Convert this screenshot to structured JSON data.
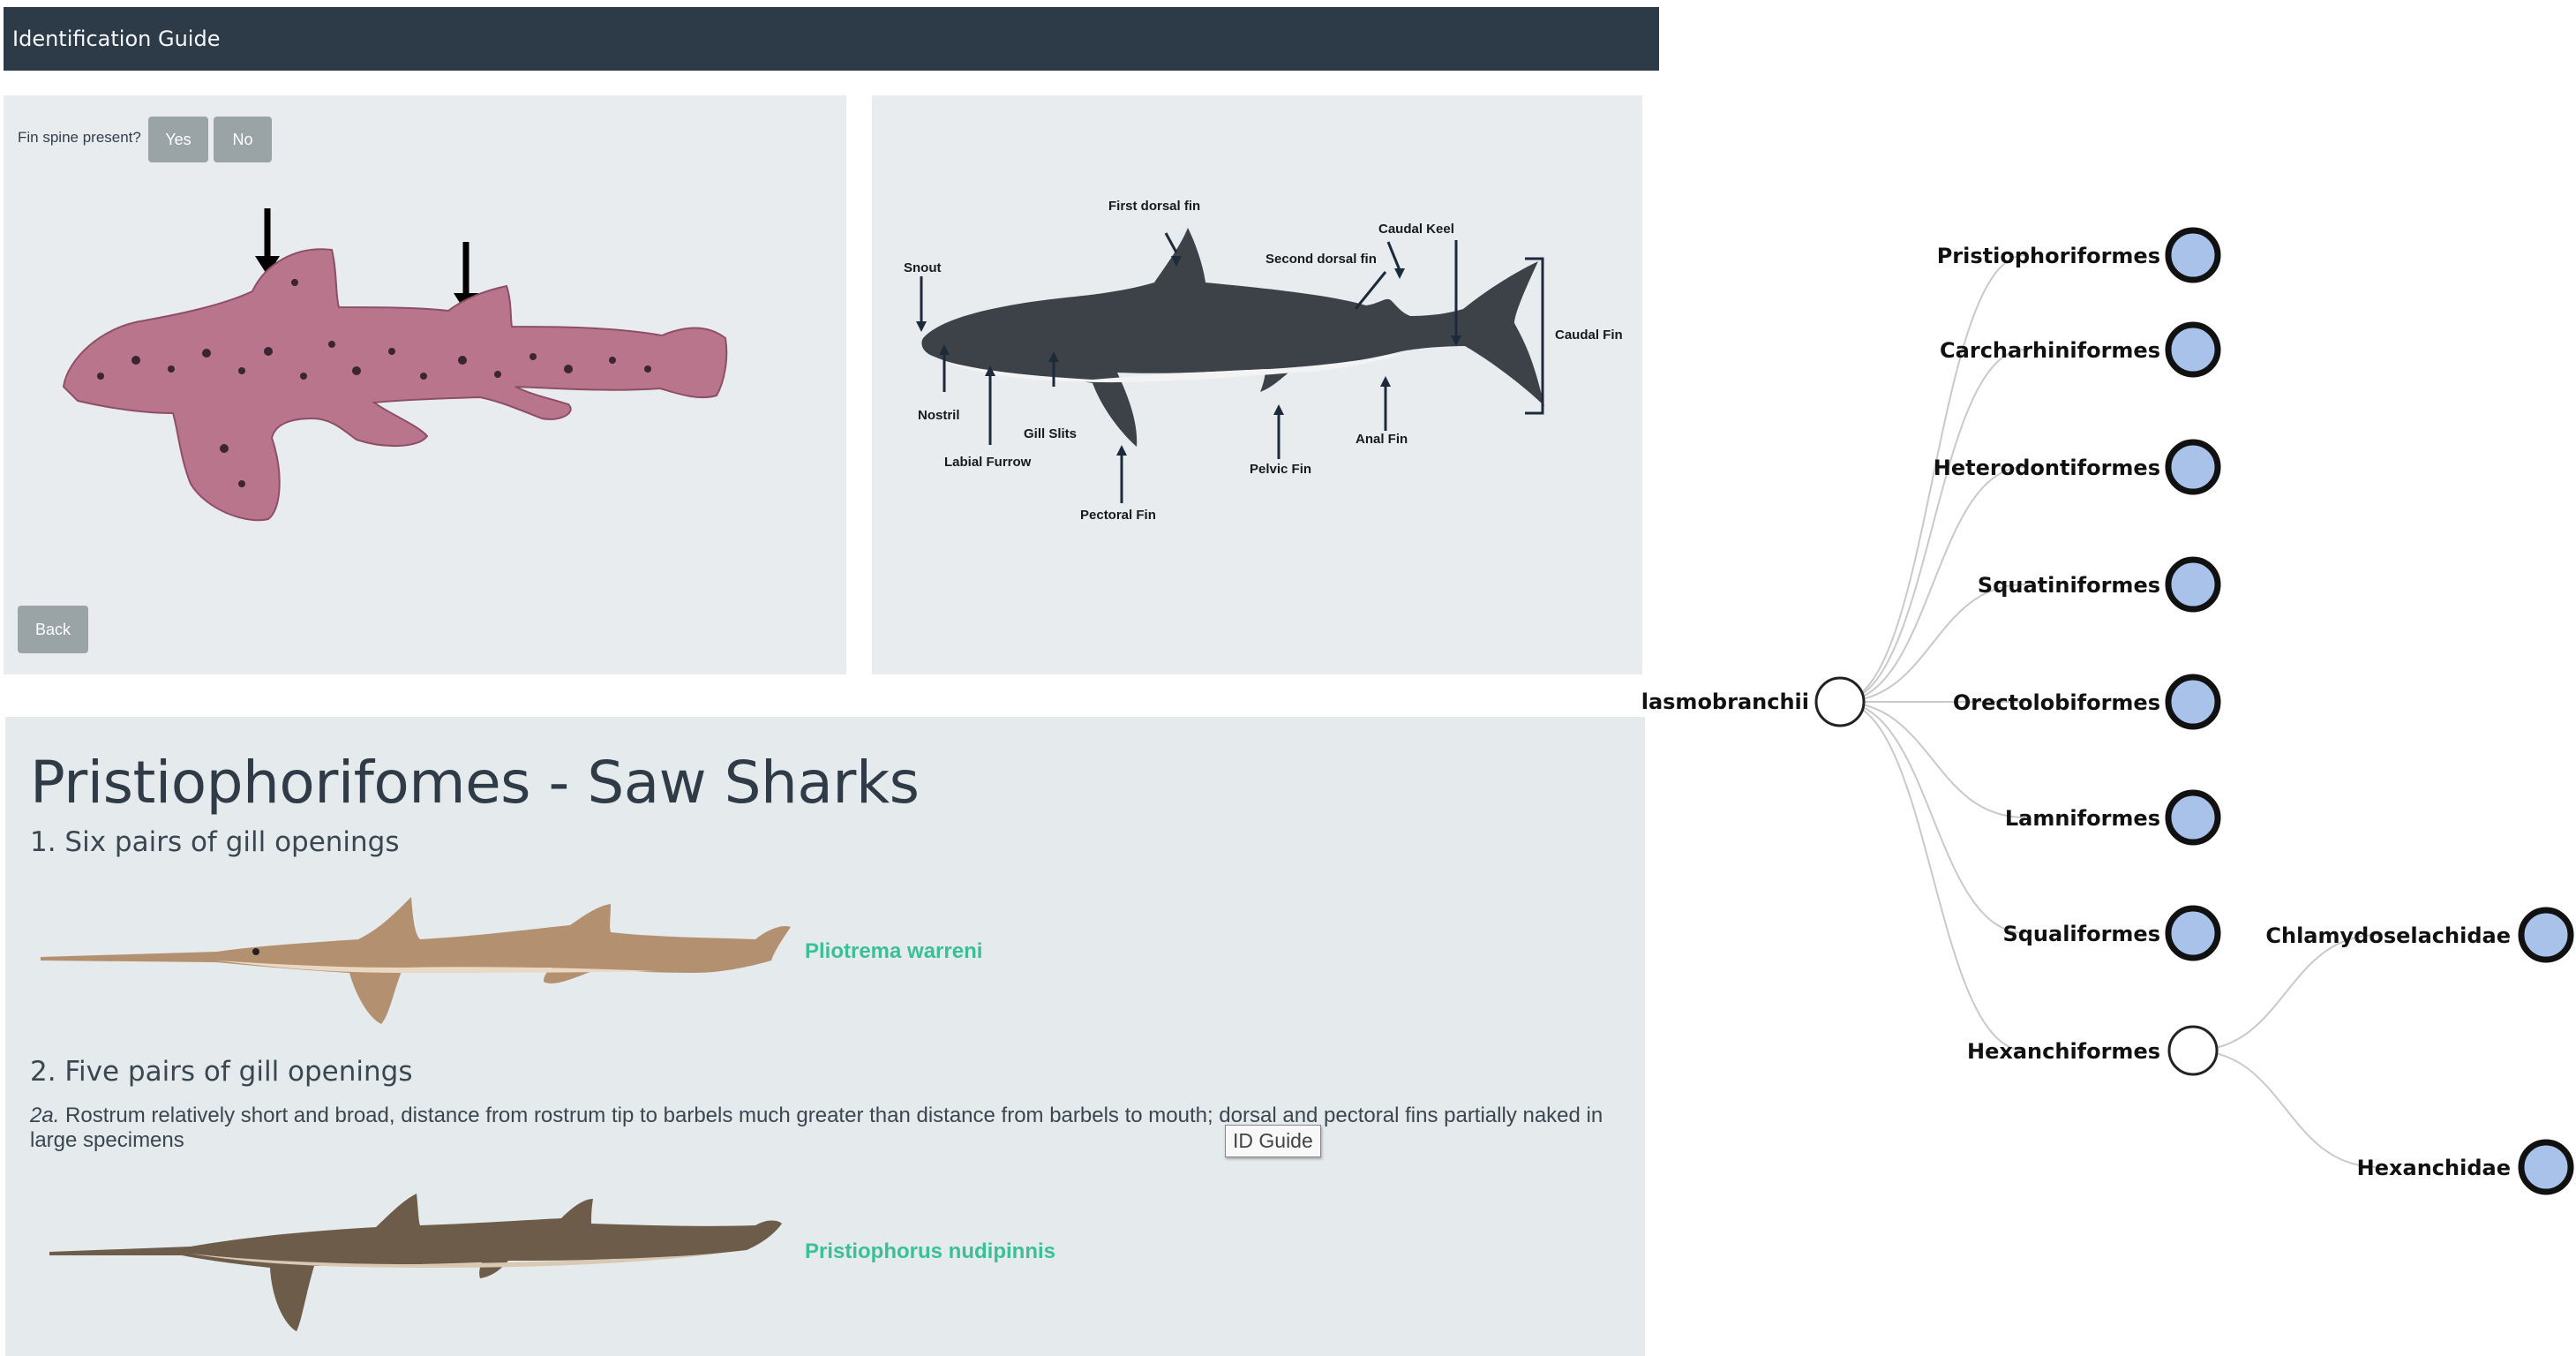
{
  "header": {
    "title": "Identification Guide"
  },
  "question": {
    "text": "Fin spine present?",
    "yes": "Yes",
    "no": "No",
    "back": "Back"
  },
  "diagram": {
    "first_dorsal": "First dorsal fin",
    "caudal_keel": "Caudal Keel",
    "second_dorsal": "Second dorsal fin",
    "snout": "Snout",
    "caudal_fin": "Caudal Fin",
    "nostril": "Nostril",
    "gill_slits": "Gill Slits",
    "labial": "Labial Furrow",
    "anal": "Anal Fin",
    "pelvic": "Pelvic Fin",
    "pectoral": "Pectoral Fin"
  },
  "guide": {
    "heading": "Pristiophorifomes - Saw Sharks",
    "point1": "1. Six pairs of gill openings",
    "species1": "Pliotrema warreni",
    "point2": "2. Five pairs of gill openings",
    "point2a_num": "2a.",
    "point2a_text": "Rostrum relatively short and broad, distance from rostrum tip to barbels much greater than distance from barbels to mouth; dorsal and pectoral fins partially naked in large specimens",
    "species2": "Pristiophorus nudipinnis",
    "tooltip": "ID Guide"
  },
  "tree": {
    "root": "Elasmobranchii",
    "orders": [
      "Pristiophoriformes",
      "Carcharhiniformes",
      "Heterodontiformes",
      "Squatiniformes",
      "Orectolobiformes",
      "Lamniformes",
      "Squaliformes",
      "Hexanchiformes"
    ],
    "families": [
      "Chlamydoselachidae",
      "Hexanchidae"
    ],
    "node_color": "#a9c2ea"
  }
}
